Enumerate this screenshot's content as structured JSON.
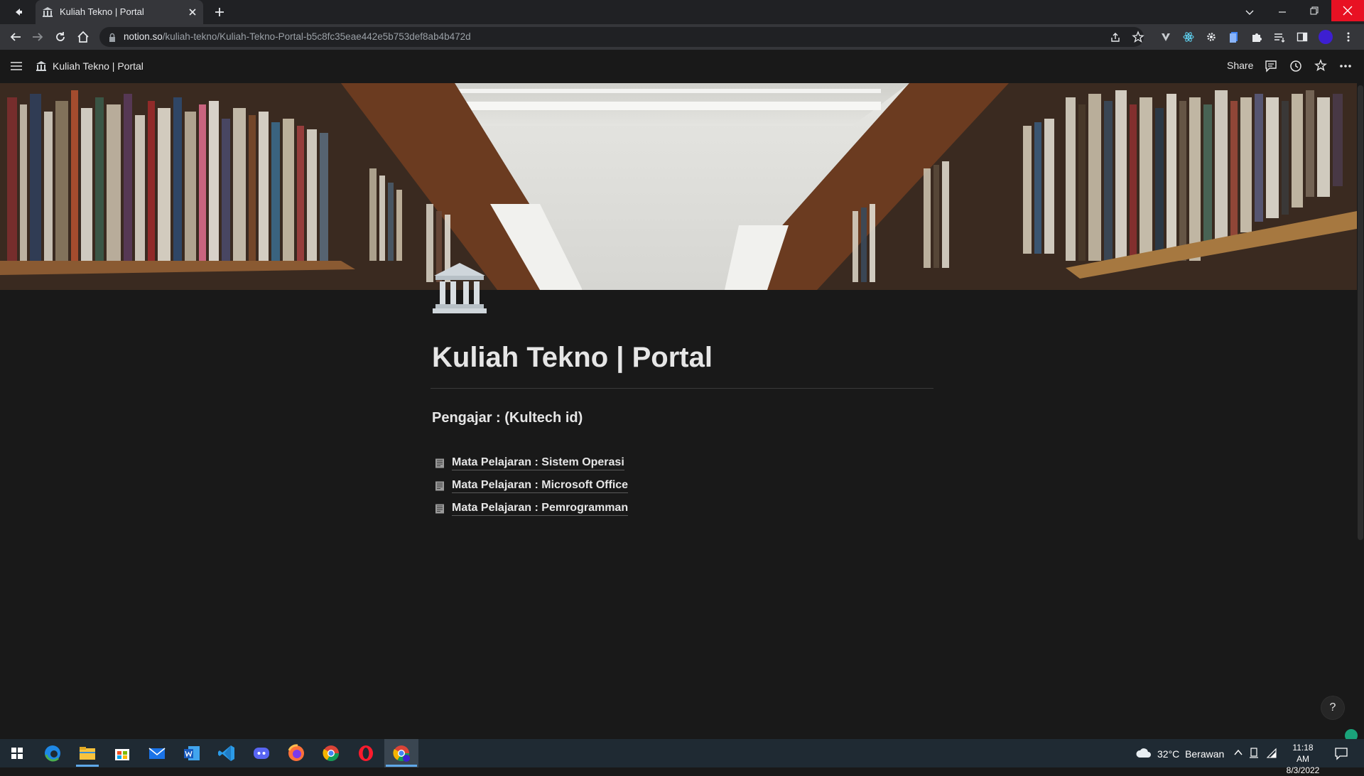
{
  "browser": {
    "tab_title": "Kuliah Tekno | Portal",
    "url_domain": "notion.so",
    "url_path": "/kuliah-tekno/Kuliah-Tekno-Portal-b5c8fc35eae442e5b753def8ab4b472d"
  },
  "topbar": {
    "breadcrumb": "Kuliah Tekno | Portal",
    "share_label": "Share"
  },
  "page": {
    "title": "Kuliah Tekno | Portal",
    "teacher": "Pengajar : (Kultech id)",
    "links": [
      {
        "label": "Mata Pelajaran : Sistem Operasi"
      },
      {
        "label": "Mata Pelajaran : Microsoft Office"
      },
      {
        "label": "Mata Pelajaran : Pemrogramman"
      }
    ],
    "help_label": "?"
  },
  "taskbar": {
    "weather_temp": "32°C",
    "weather_text": "Berawan",
    "time": "11:18 AM",
    "date": "8/3/2022",
    "apps": [
      "windows-start",
      "edge",
      "file-explorer",
      "microsoft-store",
      "mail",
      "word",
      "vscode",
      "discord",
      "firefox",
      "chrome",
      "opera",
      "chrome-active"
    ]
  },
  "colors": {
    "page_bg": "#191919",
    "text": "#e6e6e6",
    "close_red": "#e81123",
    "taskbar": "#1f2a33"
  }
}
